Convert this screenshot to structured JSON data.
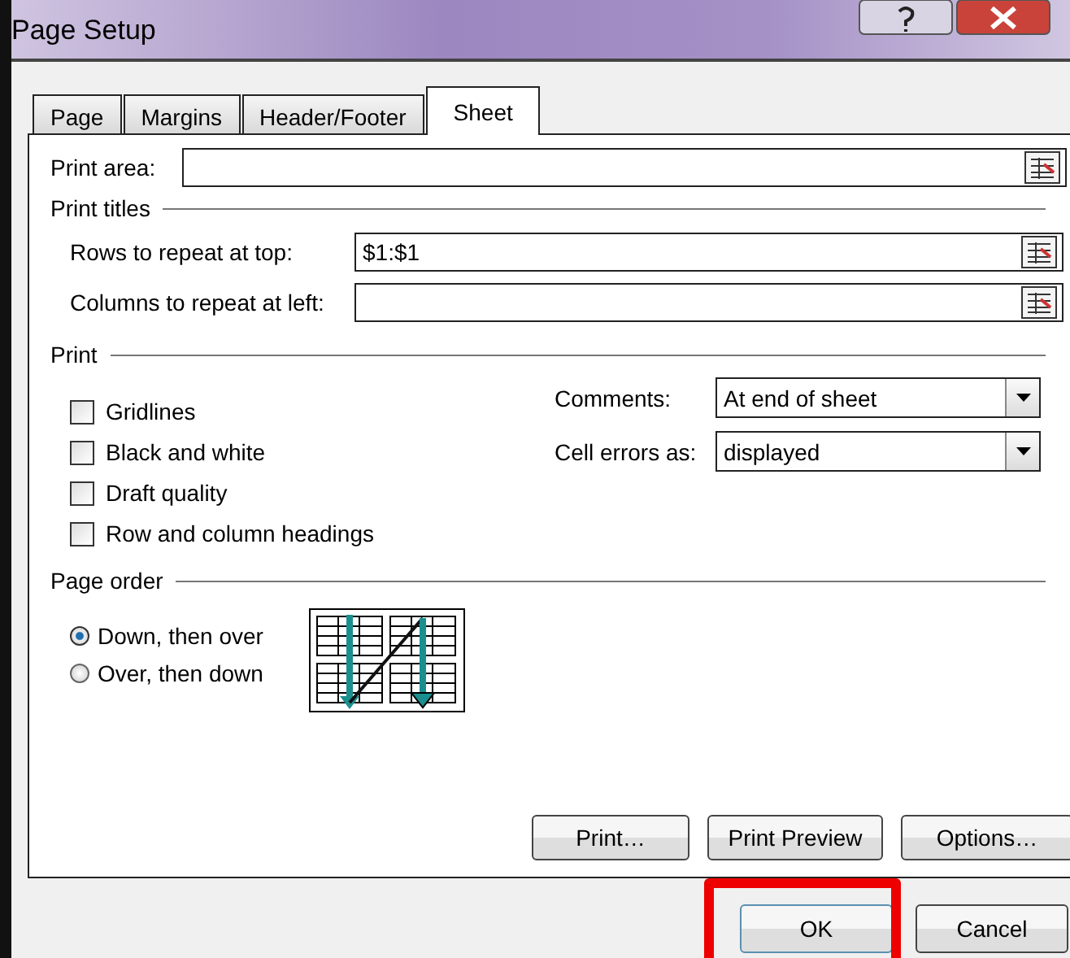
{
  "window": {
    "title": "Page Setup"
  },
  "tabs": [
    {
      "label": "Page",
      "selected": false
    },
    {
      "label": "Margins",
      "selected": false
    },
    {
      "label": "Header/Footer",
      "selected": false
    },
    {
      "label": "Sheet",
      "selected": true
    }
  ],
  "print_area": {
    "label": "Print area:"
  },
  "print_titles": {
    "heading": "Print titles",
    "fields": [
      {
        "label": "Rows to repeat at top:",
        "value": "$1:$1"
      },
      {
        "label": "Columns to repeat at left:"
      }
    ]
  },
  "print": {
    "heading": "Print",
    "options": [
      {
        "label": "Gridlines",
        "checked": false
      },
      {
        "label": "Black and white",
        "checked": false
      },
      {
        "label": "Draft quality",
        "checked": false
      },
      {
        "label": "Row and column headings",
        "checked": false
      }
    ],
    "dropdowns": [
      {
        "label": "Comments:",
        "value": "At end of sheet"
      },
      {
        "label": "Cell errors as:",
        "value": "displayed"
      }
    ]
  },
  "page_order": {
    "heading": "Page order",
    "options": [
      {
        "label": "Down, then over",
        "selected": true
      },
      {
        "label": "Over, then down",
        "selected": false
      }
    ]
  },
  "buttons": [
    {
      "label": "Print…"
    },
    {
      "label": "Print Preview"
    },
    {
      "label": "Options…"
    }
  ],
  "footer_buttons": [
    {
      "label": "OK",
      "highlighted": true
    },
    {
      "label": "Cancel",
      "highlighted": false
    }
  ]
}
